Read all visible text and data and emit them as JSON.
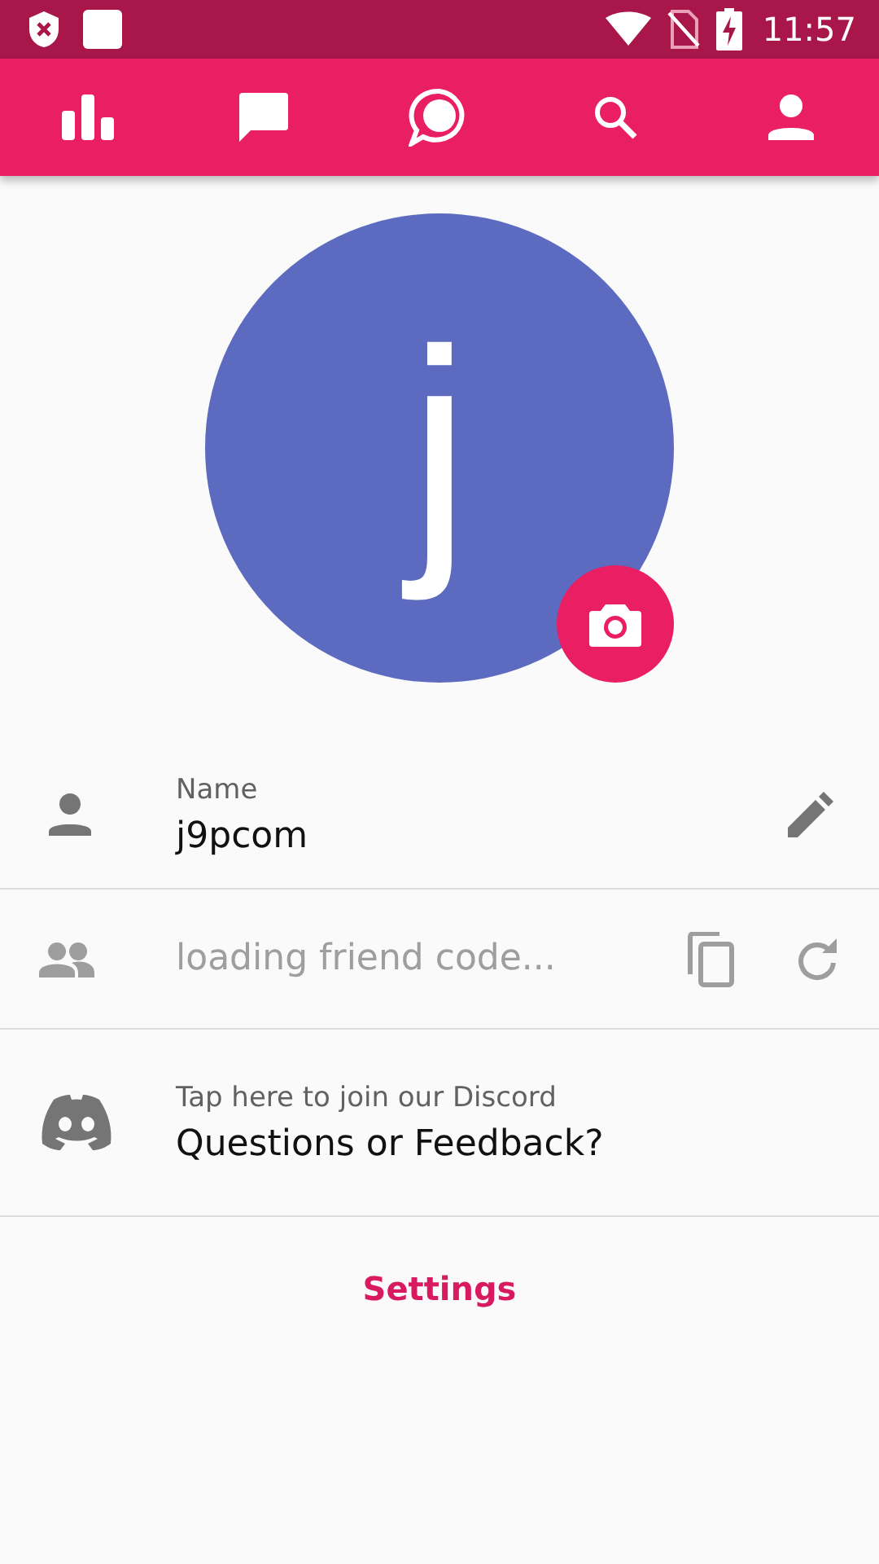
{
  "status_bar": {
    "time": "11:57"
  },
  "nav_tabs": [
    {
      "kind": "stats"
    },
    {
      "kind": "chat"
    },
    {
      "kind": "bubble"
    },
    {
      "kind": "search"
    },
    {
      "kind": "profile"
    }
  ],
  "avatar": {
    "letter": "j"
  },
  "name_row": {
    "label": "Name",
    "value": "j9pcom"
  },
  "friend_code_row": {
    "text": "loading friend code..."
  },
  "discord_row": {
    "hint": "Tap here to join our Discord",
    "title": "Questions or Feedback?"
  },
  "settings_link": "Settings"
}
